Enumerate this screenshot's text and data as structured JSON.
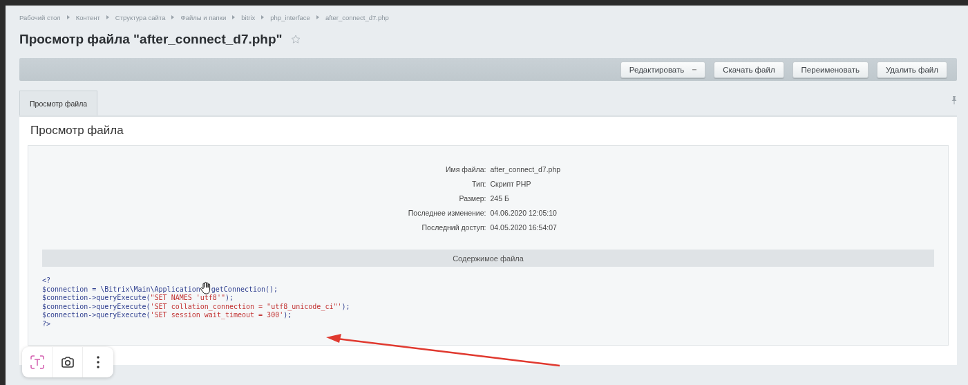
{
  "breadcrumbs": [
    "Рабочий стол",
    "Контент",
    "Структура сайта",
    "Файлы и папки",
    "bitrix",
    "php_interface",
    "after_connect_d7.php"
  ],
  "title": "Просмотр файла \"after_connect_d7.php\"",
  "favorite": false,
  "toolbar": [
    {
      "label": "Редактировать",
      "kind": "dropdown"
    },
    {
      "label": "Скачать файл",
      "kind": "button"
    },
    {
      "label": "Переименовать",
      "kind": "button"
    },
    {
      "label": "Удалить файл",
      "kind": "button"
    }
  ],
  "tabs": [
    {
      "label": "Просмотр файла",
      "selected": true
    }
  ],
  "section_title": "Просмотр файла",
  "properties": [
    {
      "label": "Имя файла:",
      "value": "after_connect_d7.php"
    },
    {
      "label": "Тип:",
      "value": "Скрипт PHP"
    },
    {
      "label": "Размер:",
      "value": "245 Б"
    },
    {
      "label": "Последнее изменение:",
      "value": "04.06.2020 12:05:10"
    },
    {
      "label": "Последний доступ:",
      "value": "04.05.2020 16:54:07"
    }
  ],
  "content_header": "Содержимое файла",
  "code_lines": [
    [
      {
        "kind": "code",
        "text": "<?"
      }
    ],
    [
      {
        "kind": "code",
        "text": "$connection = \\Bitrix\\Main\\Application"
      },
      {
        "kind": "cursor"
      },
      {
        "kind": "code",
        "text": "getConnection();"
      }
    ],
    [
      {
        "kind": "code",
        "text": "$connection->queryExecute("
      },
      {
        "kind": "string",
        "text": "\"SET NAMES 'utf8'\""
      },
      {
        "kind": "code",
        "text": ");"
      }
    ],
    [
      {
        "kind": "code",
        "text": "$connection->queryExecute("
      },
      {
        "kind": "string",
        "text": "'SET collation_connection = \"utf8_unicode_ci\"'"
      },
      {
        "kind": "code",
        "text": ");"
      }
    ],
    [
      {
        "kind": "code",
        "text": "$connection->queryExecute("
      },
      {
        "kind": "string",
        "text": "'SET session wait_timeout = 300'"
      },
      {
        "kind": "code",
        "text": ");"
      }
    ],
    [
      {
        "kind": "code",
        "text": "?>"
      }
    ]
  ]
}
